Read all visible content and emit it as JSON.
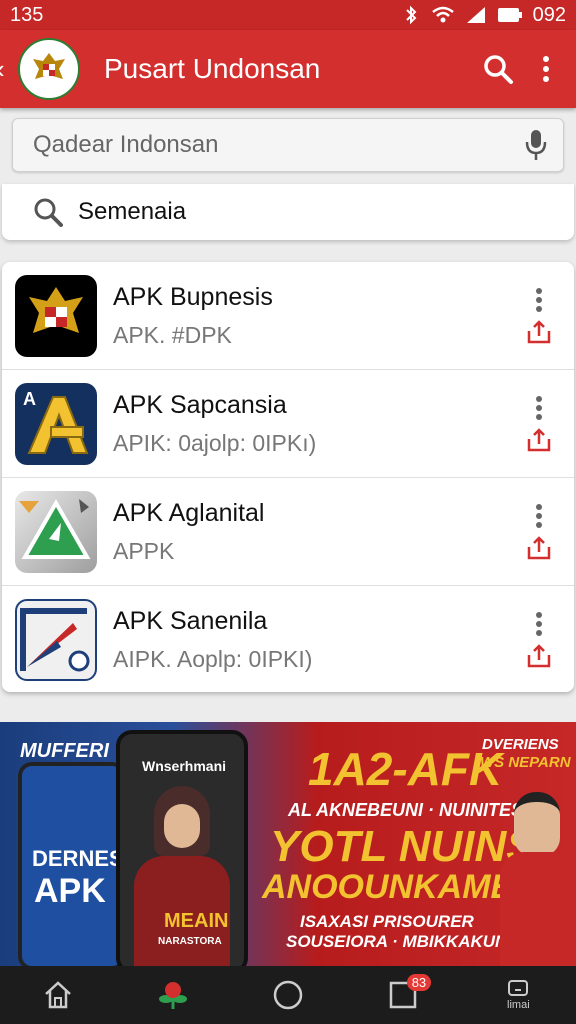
{
  "status": {
    "time": "135",
    "battery": "092"
  },
  "header": {
    "title": "Pusart Undonsan"
  },
  "search": {
    "placeholder": "Qadear Indonsan"
  },
  "suggestion": {
    "text": "Semenaia"
  },
  "apps": [
    {
      "title": "APK Bupnesis",
      "subtitle": "APK. #DPK"
    },
    {
      "title": "APK Sapcansia",
      "subtitle": "APIK: 0ajolp: 0IPKı)"
    },
    {
      "title": "APK Aglanital",
      "subtitle": "APPK"
    },
    {
      "title": "APK Sanenila",
      "subtitle": "AIPK. Aoplp: 0IPKI)"
    }
  ],
  "banner": {
    "left_label": "MUFFERI",
    "phone1_text": "DERNES",
    "phone1_apk": "APK",
    "phone2_top": "Wnserhmani",
    "phone2_bottom": "MEAIN",
    "phone2_small": "NARASTORA",
    "headline_top": "1A2-AFK",
    "corner_top": "DVERIENS",
    "corner_bottom": "WS NEPARN",
    "sub_headline": "AL AKNEBEUNI · NUINITESR",
    "headline_1": "YOTL NUINS",
    "headline_2": "ANOOUNKAMES",
    "footer_1": "ISAXASI PRISOURER",
    "footer_2": "SOUSEIORA · MBIKKAKUNA"
  },
  "nav": {
    "badge": "83",
    "last_label": "limai"
  },
  "colors": {
    "primary": "#d32f2f",
    "status": "#c62828",
    "accent_icon": "#d32f2f"
  }
}
